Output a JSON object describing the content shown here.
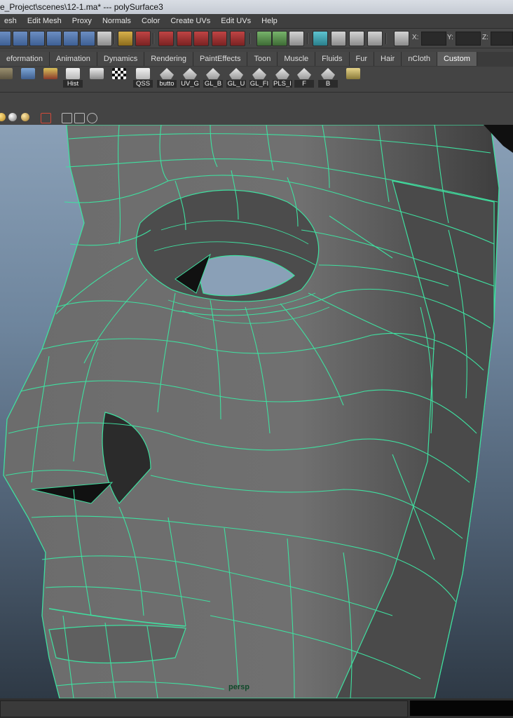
{
  "window": {
    "title": "e_Project\\scenes\\12-1.ma*   ---   polySurface3"
  },
  "menu": [
    "esh",
    "Edit Mesh",
    "Proxy",
    "Normals",
    "Color",
    "Create UVs",
    "Edit UVs",
    "Help"
  ],
  "status_line": {
    "x_label": "X:",
    "y_label": "Y:",
    "z_label": "Z:",
    "x_value": "",
    "y_value": "",
    "z_value": ""
  },
  "shelf_tabs": [
    "eformation",
    "Animation",
    "Dynamics",
    "Rendering",
    "PaintEffects",
    "Toon",
    "Muscle",
    "Fluids",
    "Fur",
    "Hair",
    "nCloth",
    "Custom"
  ],
  "active_shelf_tab": "Custom",
  "shelf_buttons": [
    {
      "icon": "mesh-tool-icon",
      "label": ""
    },
    {
      "icon": "uv-layout-icon",
      "label": ""
    },
    {
      "icon": "paint-texture-icon",
      "label": ""
    },
    {
      "icon": "pencil-icon",
      "label": "Hist"
    },
    {
      "icon": "select-tool-icon",
      "label": ""
    },
    {
      "icon": "checker-icon",
      "label": ""
    },
    {
      "icon": "pencil-icon",
      "label": "QSS"
    },
    {
      "icon": "mel-script-icon",
      "label": "butto"
    },
    {
      "icon": "mel-script-icon",
      "label": "UV_G"
    },
    {
      "icon": "mel-script-icon",
      "label": "GL_B"
    },
    {
      "icon": "mel-script-icon",
      "label": "GL_U"
    },
    {
      "icon": "mel-script-icon",
      "label": "GL_FI"
    },
    {
      "icon": "mel-script-icon",
      "label": "PLS_I"
    },
    {
      "icon": "mel-script-icon",
      "label": "F"
    },
    {
      "icon": "mel-script-icon",
      "label": "B"
    },
    {
      "icon": "uv-plane-icon",
      "label": ""
    }
  ],
  "viewport": {
    "camera_label": "persp",
    "wire_color": "#3fe0a0"
  },
  "colors": {
    "wireframe": "#3fe0a0",
    "sky_top": "#8aa0b7",
    "sky_bottom": "#2e3945"
  }
}
